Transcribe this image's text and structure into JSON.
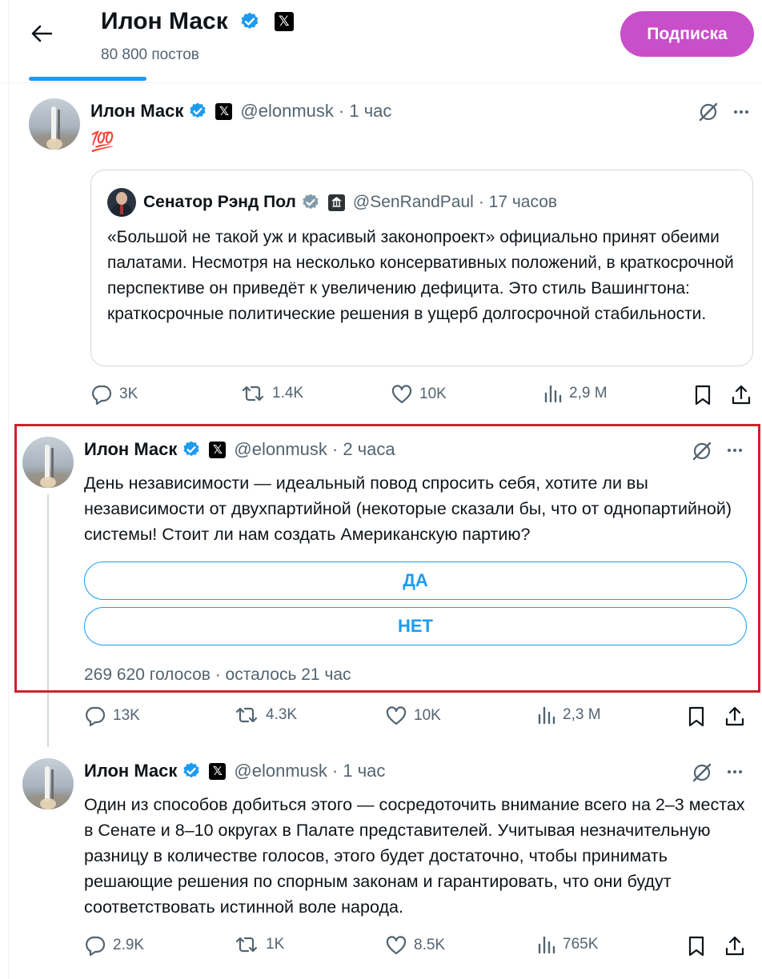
{
  "header": {
    "title": "Илон Маск",
    "posts_count": "80 800 постов",
    "subscribe_label": "Подписка"
  },
  "tweets": [
    {
      "name": "Илон Маск",
      "handle": "@elonmusk",
      "time": "· 1 час",
      "text": "💯",
      "quote": {
        "name": "Сенатор Рэнд Пол",
        "handle": "@SenRandPaul",
        "time": "· 17 часов",
        "text": "«Большой не такой уж и красивый законопроект» официально принят обеими палатами. Несмотря на несколько консервативных положений, в краткосрочной перспективе он приведёт к увеличению дефицита. Это стиль Вашингтона: краткосрочные политические решения в ущерб долгосрочной стабильности."
      },
      "stats": {
        "replies": "3K",
        "reposts": "1.4K",
        "likes": "10K",
        "views": "2,9 M"
      }
    },
    {
      "name": "Илон Маск",
      "handle": "@elonmusk",
      "time": "· 2 часа",
      "text": "День независимости — идеальный повод спросить себя, хотите ли вы независимости от двухпартийной (некоторые сказали бы, что от однопартийной) системы! Стоит ли нам создать Американскую партию?",
      "poll": {
        "options": [
          "ДА",
          "НЕТ"
        ],
        "meta": "269 620 голосов · осталось 21 час"
      },
      "stats": {
        "replies": "13K",
        "reposts": "4.3K",
        "likes": "10K",
        "views": "2,3 M"
      }
    },
    {
      "name": "Илон Маск",
      "handle": "@elonmusk",
      "time": "· 1 час",
      "text": "Один из способов добиться этого — сосредоточить внимание всего на 2–3 местах в Сенате и 8–10 округах в Палате представителей. Учитывая незначительную разницу в количестве голосов, этого будет достаточно, чтобы принимать решающие решения по спорным законам и гарантировать, что они будут соответствовать истинной воле народа.",
      "stats": {
        "replies": "2.9K",
        "reposts": "1K",
        "likes": "8.5K",
        "views": "765K"
      }
    }
  ],
  "icons": {
    "back": "arrow-left-icon",
    "verified": "verified-badge-icon",
    "x_affiliate": "x-logo-icon",
    "grok": "grok-icon",
    "more": "more-icon",
    "reply": "reply-icon",
    "repost": "repost-icon",
    "like": "heart-icon",
    "views": "views-icon",
    "bookmark": "bookmark-icon",
    "share": "share-icon"
  },
  "colors": {
    "accent": "#1d9bf0",
    "subscribe_bg": "#c94ec9",
    "highlight_border": "#d4202a",
    "muted_text": "#536471"
  }
}
